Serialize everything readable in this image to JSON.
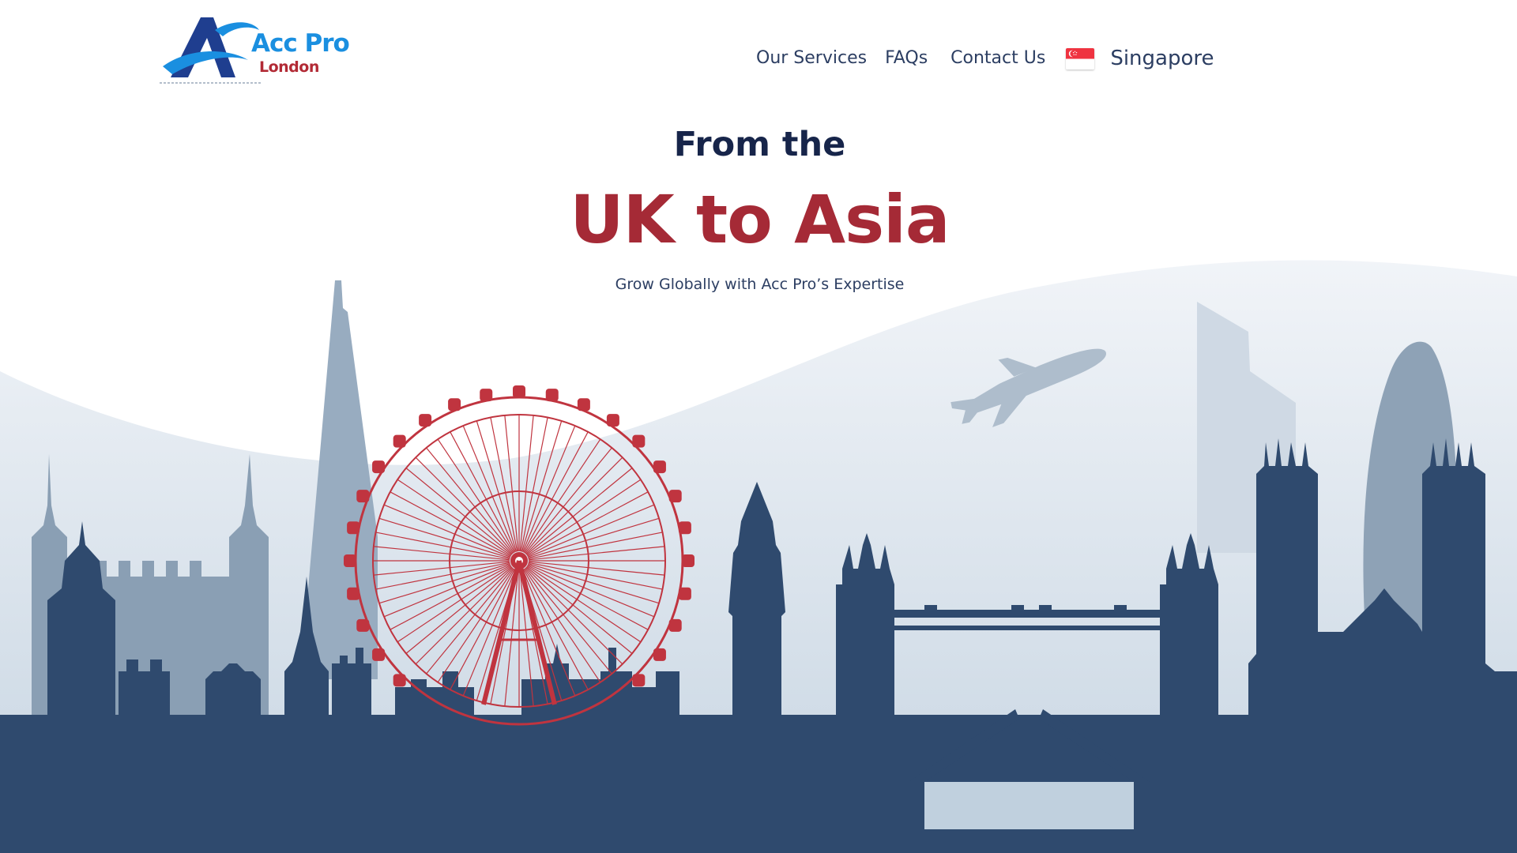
{
  "brand": {
    "name": "Acc Pro",
    "subname": "London",
    "primary_color": "#1a8fe0",
    "secondary_color": "#b22a35",
    "dark_blue": "#1f3e8f"
  },
  "nav": {
    "items": [
      {
        "label": "Our Services"
      },
      {
        "label": "FAQs"
      },
      {
        "label": "Contact Us"
      }
    ],
    "region": {
      "label": "Singapore",
      "flag_icon": "singapore-flag-icon"
    }
  },
  "hero": {
    "kicker": "From the",
    "title": "UK to Asia",
    "subtitle": "Grow Globally with Acc Pro’s Expertise"
  },
  "colors": {
    "navy": "#17254a",
    "accent_red": "#a52a36",
    "skyline_dark": "#2f4a6e",
    "skyline_mid": "#8aa0b8",
    "skyline_light": "#a9bdd0",
    "sky": "#dde6ef"
  },
  "illustration": {
    "icons": [
      "london-eye-icon",
      "airplane-icon",
      "tower-bridge-icon",
      "big-ben-icon",
      "shard-icon",
      "gherkin-icon"
    ]
  }
}
